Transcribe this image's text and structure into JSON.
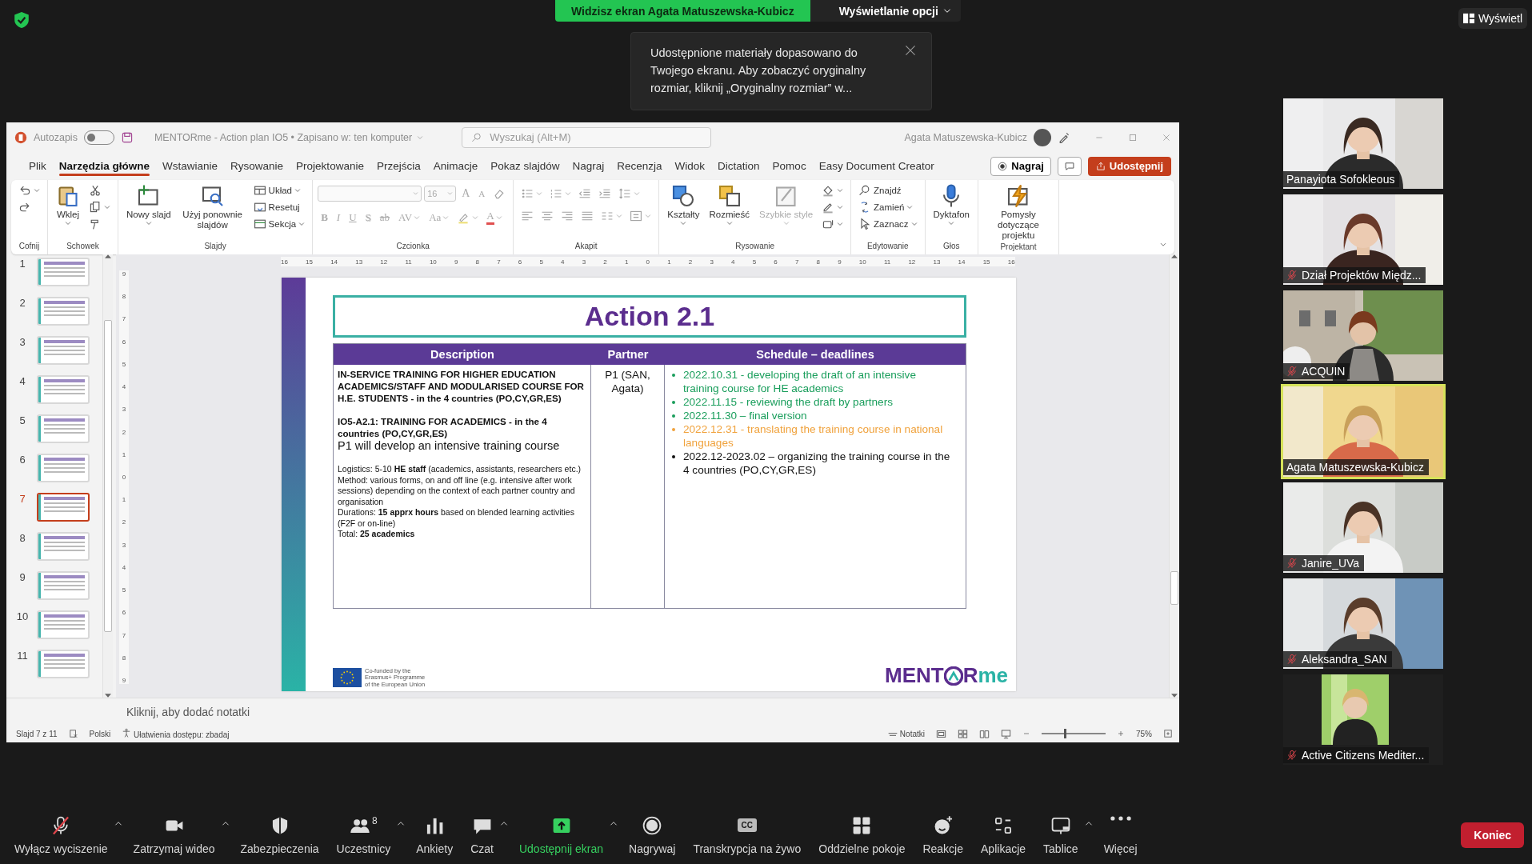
{
  "meeting": {
    "sharing_banner": "Widzisz ekran Agata Matuszewska-Kubicz",
    "view_options": "Wyświetlanie opcji",
    "notice": "Udostępnione materiały dopasowano do Twojego ekranu. Aby zobaczyć oryginalny rozmiar, kliknij „Oryginalny rozmiar” w...",
    "view_button": "Wyświetl"
  },
  "app": {
    "titlebar": {
      "autosave_label": "Autozapis",
      "autosave_on": false,
      "document": "MENTORme - Action plan IO5 • Zapisano w: ten komputer",
      "search_placeholder": "Wyszukaj (Alt+M)",
      "user": "Agata Matuszewska-Kubicz"
    },
    "tabs": [
      {
        "label": "Plik",
        "selected": false
      },
      {
        "label": "Narzędzia główne",
        "selected": true
      },
      {
        "label": "Wstawianie",
        "selected": false
      },
      {
        "label": "Rysowanie",
        "selected": false
      },
      {
        "label": "Projektowanie",
        "selected": false
      },
      {
        "label": "Przejścia",
        "selected": false
      },
      {
        "label": "Animacje",
        "selected": false
      },
      {
        "label": "Pokaz slajdów",
        "selected": false
      },
      {
        "label": "Nagraj",
        "selected": false
      },
      {
        "label": "Recenzja",
        "selected": false
      },
      {
        "label": "Widok",
        "selected": false
      },
      {
        "label": "Dictation",
        "selected": false
      },
      {
        "label": "Pomoc",
        "selected": false
      },
      {
        "label": "Easy Document Creator",
        "selected": false
      }
    ],
    "record_button": "Nagraj",
    "share_button": "Udostępnij",
    "ribbon": [
      {
        "label": "Cofnij",
        "disabled": false,
        "columns": [
          [
            {
              "kind": "undo",
              "caret": true
            },
            {
              "kind": "redo"
            }
          ]
        ]
      },
      {
        "label": "Schowek",
        "disabled": false,
        "columns": [
          [
            {
              "kind": "paste",
              "label": "Wklej",
              "caret": true
            }
          ],
          [
            {
              "kind": "cut"
            },
            {
              "kind": "copy",
              "caret": true
            },
            {
              "kind": "brush"
            }
          ]
        ]
      },
      {
        "label": "Slajdy",
        "disabled": false,
        "columns": [
          [
            {
              "kind": "new-slide",
              "label": "Nowy slajd",
              "caret": true
            }
          ],
          [
            {
              "kind": "reuse",
              "label": "Użyj ponownie slajdów"
            }
          ],
          [
            {
              "kind": "layout",
              "label": "Układ",
              "caret": true
            },
            {
              "kind": "reset",
              "label": "Resetuj"
            },
            {
              "kind": "section",
              "label": "Sekcja",
              "caret": true
            }
          ]
        ]
      },
      {
        "label": "Czcionka",
        "disabled": true,
        "top_line": [
          {
            "kind": "font-field"
          },
          {
            "kind": "size-field",
            "value": "16"
          },
          {
            "kind": "grow",
            "label": "A"
          },
          {
            "kind": "shrink",
            "label": "A"
          },
          {
            "kind": "eraser"
          }
        ],
        "bottom_line": [
          {
            "kind": "bold",
            "label": "B"
          },
          {
            "kind": "italic",
            "label": "I"
          },
          {
            "kind": "underline",
            "label": "U"
          },
          {
            "kind": "shadow",
            "label": "S"
          },
          {
            "kind": "strike",
            "label": "ab"
          },
          {
            "kind": "spacing",
            "label": "AV",
            "caret": true
          },
          {
            "kind": "case",
            "label": "Aa",
            "caret": true
          },
          {
            "kind": "marker",
            "caret": true
          },
          {
            "kind": "font-color",
            "label": "A",
            "caret": true
          }
        ]
      },
      {
        "label": "Akapit",
        "disabled": true,
        "top_line": [
          {
            "kind": "bullets",
            "caret": true
          },
          {
            "kind": "numbering",
            "caret": true
          },
          {
            "kind": "outdent"
          },
          {
            "kind": "indent"
          },
          {
            "kind": "line-spacing",
            "caret": true
          }
        ],
        "bottom_line": [
          {
            "kind": "align-left"
          },
          {
            "kind": "align-center"
          },
          {
            "kind": "align-right"
          },
          {
            "kind": "justify"
          },
          {
            "kind": "columns",
            "caret": true
          },
          {
            "kind": "text-align",
            "caret": true
          }
        ]
      },
      {
        "label": "Rysowanie",
        "disabled": false,
        "columns": [
          [
            {
              "kind": "shapes",
              "label": "Kształty",
              "caret": true
            }
          ],
          [
            {
              "kind": "arrange",
              "label": "Rozmieść",
              "caret": true
            }
          ],
          [
            {
              "kind": "styles",
              "label": "Szybkie style",
              "caret": true,
              "disabled": true
            }
          ],
          [
            {
              "kind": "fill",
              "caret": true
            },
            {
              "kind": "outline",
              "caret": true
            },
            {
              "kind": "effects",
              "caret": true
            }
          ]
        ]
      },
      {
        "label": "Edytowanie",
        "disabled": false,
        "columns": [
          [
            {
              "kind": "find",
              "label": "Znajdź"
            },
            {
              "kind": "replace",
              "label": "Zamień",
              "caret": true
            },
            {
              "kind": "select",
              "label": "Zaznacz",
              "caret": true
            }
          ]
        ]
      },
      {
        "label": "Głos",
        "disabled": false,
        "columns": [
          [
            {
              "kind": "mic",
              "label": "Dyktafon",
              "caret": true
            }
          ]
        ]
      },
      {
        "label": "Projektant",
        "disabled": false,
        "columns": [
          [
            {
              "kind": "ideas",
              "label": "Pomysły dotyczące projektu"
            }
          ]
        ]
      }
    ],
    "thumbnails": [
      {
        "number": "1",
        "selected": false
      },
      {
        "number": "2",
        "selected": false
      },
      {
        "number": "3",
        "selected": false
      },
      {
        "number": "4",
        "selected": false
      },
      {
        "number": "5",
        "selected": false
      },
      {
        "number": "6",
        "selected": false
      },
      {
        "number": "7",
        "selected": true
      },
      {
        "number": "8",
        "selected": false
      },
      {
        "number": "9",
        "selected": false
      },
      {
        "number": "10",
        "selected": false
      },
      {
        "number": "11",
        "selected": false
      }
    ],
    "ruler_h": [
      "16",
      "15",
      "14",
      "13",
      "12",
      "11",
      "10",
      "9",
      "8",
      "7",
      "6",
      "5",
      "4",
      "3",
      "2",
      "1",
      "0",
      "1",
      "2",
      "3",
      "4",
      "5",
      "6",
      "7",
      "8",
      "9",
      "10",
      "11",
      "12",
      "13",
      "14",
      "15",
      "16"
    ],
    "ruler_v": [
      "9",
      "8",
      "7",
      "6",
      "5",
      "4",
      "3",
      "2",
      "1",
      "0",
      "1",
      "2",
      "3",
      "4",
      "5",
      "6",
      "7",
      "8",
      "9"
    ],
    "slide": {
      "title": "Action 2.1",
      "columns": [
        "Description",
        "Partner",
        "Schedule – deadlines"
      ],
      "description": [
        {
          "kind": "heading",
          "text": "IN-SERVICE TRAINING FOR HIGHER EDUCATION ACADEMICS/STAFF AND MODULARISED COURSE FOR H.E. STUDENTS - in the 4 countries (PO,CY,GR,ES)"
        },
        {
          "kind": "heading",
          "text": "IO5-A2.1: TRAINING FOR ACADEMICS - in the 4 countries (PO,CY,GR,ES)"
        },
        {
          "kind": "lead",
          "text": "P1 will develop an intensive training course"
        },
        {
          "kind": "note",
          "text": "Logistics: 5-10 **HE staff** (academics, assistants, researchers etc.)"
        },
        {
          "kind": "note",
          "text": "Method: various forms, on and off line (e.g. intensive after work sessions) depending on the context of each partner country and organisation"
        },
        {
          "kind": "note",
          "text": "Durations: **15 apprx hours** based on blended learning activities (F2F or on-line)"
        },
        {
          "kind": "note",
          "text": "Total: **25 academics**"
        }
      ],
      "partner": "P1 (SAN, Agata)",
      "schedule": [
        {
          "text": "2022.10.31 - developing the draft of an intensive training course for HE academics",
          "color": "#1a9e5c"
        },
        {
          "text": "2022.11.15 - reviewing the draft by partners",
          "color": "#1a9e5c"
        },
        {
          "text": "2022.11.30 – final version",
          "color": "#1a9e5c"
        },
        {
          "text": "2022.12.31 - translating the training course in national languages",
          "color": "#f0a23c"
        },
        {
          "text": "2022.12-2023.02 – organizing the training course in the 4 countries (PO,CY,GR,ES)",
          "color": "#111111"
        }
      ],
      "funding": [
        "Co-funded by the",
        "Erasmus+ Programme",
        "of the European Union"
      ],
      "logo": {
        "start": "MENT",
        "end": "R",
        "suffix": "me"
      }
    },
    "notes_placeholder": "Kliknij, aby dodać notatki",
    "status_bar": {
      "slide": "Slajd 7 z 11",
      "language": "Polski",
      "accessibility": "Ułatwienia dostępu: zbadaj",
      "notes": "Notatki",
      "zoom": {
        "level": 0.35,
        "reading": "75%"
      }
    }
  },
  "participants": [
    {
      "name": "Panayiota Sofokleous",
      "muted": false,
      "selected": false
    },
    {
      "name": "Dział Projektów Międz...",
      "muted": true,
      "selected": false
    },
    {
      "name": "ACQUIN",
      "muted": true,
      "selected": false
    },
    {
      "name": "Agata Matuszewska-Kubicz",
      "muted": false,
      "selected": true
    },
    {
      "name": "Janire_UVa",
      "muted": true,
      "selected": false
    },
    {
      "name": "Aleksandra_SAN",
      "muted": true,
      "selected": false
    },
    {
      "name": "Active Citizens Mediter...",
      "muted": true,
      "selected": false
    }
  ],
  "toolbar": {
    "items": [
      {
        "label": "Wyłącz wyciszenie",
        "kind": "mic-muted",
        "caret": true,
        "active": false
      },
      {
        "label": "Zatrzymaj wideo",
        "kind": "camera",
        "caret": true,
        "active": false
      },
      {
        "label": "Zabezpieczenia",
        "kind": "shield",
        "caret": false,
        "active": false
      },
      {
        "label": "Uczestnicy",
        "kind": "people",
        "count": "8",
        "caret": true,
        "active": false
      },
      {
        "label": "Ankiety",
        "kind": "chart",
        "caret": false,
        "active": false
      },
      {
        "label": "Czat",
        "kind": "chat",
        "caret": true,
        "active": false
      },
      {
        "label": "Udostępnij ekran",
        "kind": "share",
        "caret": true,
        "active": true
      },
      {
        "label": "Nagrywaj",
        "kind": "record",
        "caret": false,
        "active": false
      },
      {
        "label": "Transkrypcja na żywo",
        "kind": "cc",
        "icon_text": "CC",
        "caret": false,
        "active": false
      },
      {
        "label": "Oddzielne pokoje",
        "kind": "rooms",
        "caret": false,
        "active": false
      },
      {
        "label": "Reakcje",
        "kind": "emoji",
        "caret": false,
        "active": false
      },
      {
        "label": "Aplikacje",
        "kind": "apps",
        "caret": false,
        "active": false
      },
      {
        "label": "Tablice",
        "kind": "board",
        "caret": true,
        "active": false
      },
      {
        "label": "Więcej",
        "kind": "more",
        "caret": false,
        "active": false
      }
    ],
    "end_button": "Koniec"
  }
}
